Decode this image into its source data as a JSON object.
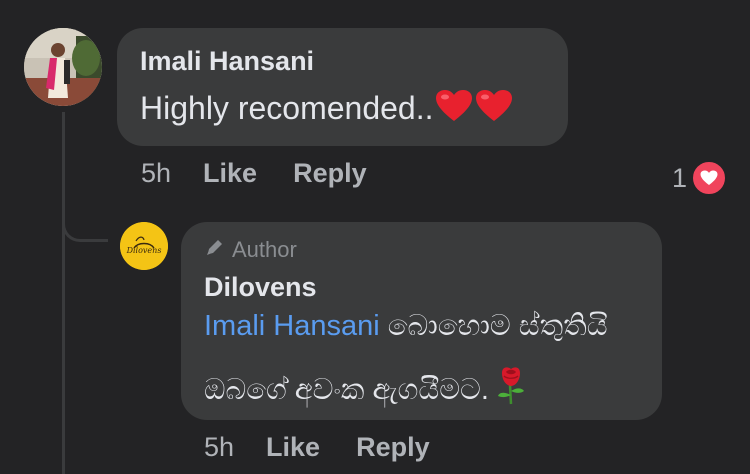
{
  "main_comment": {
    "author": "Imali Hansani",
    "text": "Highly recomended..",
    "emoji_icon": "red-heart-icon",
    "time": "5h",
    "like_label": "Like",
    "reply_label": "Reply",
    "reaction_count": "1",
    "reaction_icon": "love-reaction-icon"
  },
  "reply_comment": {
    "badge_label": "Author",
    "badge_icon": "pen-icon",
    "author": "Dilovens",
    "mention": "Imali Hansani",
    "text_line1": "බොහොම ස්තුතියි",
    "text_line2": "ඔබගේ අවංක ඇගයීමට.",
    "emoji_icon": "rose-icon",
    "time": "5h",
    "like_label": "Like",
    "reply_label": "Reply"
  },
  "colors": {
    "background": "#232325",
    "bubble": "#3a3b3c",
    "mention": "#5a9cf0",
    "reaction": "#f0445c",
    "avatar_reply_bg": "#f4c415"
  }
}
